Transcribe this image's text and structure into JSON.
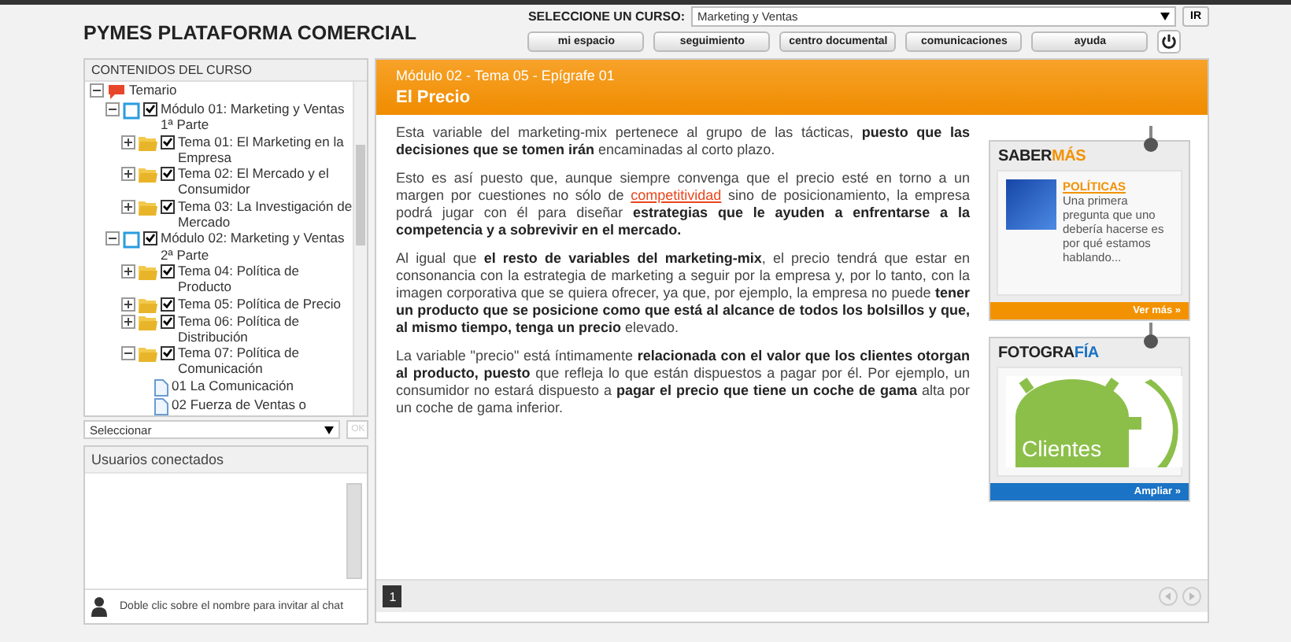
{
  "header": {
    "title": "PYMES PLATAFORMA COMERCIAL",
    "course_label": "SELECCIONE UN CURSO:",
    "course_select": {
      "value": "Marketing y Ventas"
    },
    "go_button": "IR",
    "nav": [
      "mi espacio",
      "seguimiento",
      "centro documental",
      "comunicaciones",
      "ayuda"
    ]
  },
  "contents": {
    "title": "CONTENIDOS DEL CURSO",
    "tree": [
      {
        "label": "Temario",
        "kind": "root",
        "expanded": true,
        "children": [
          {
            "label": "Módulo 01: Marketing y Ventas 1ª Parte",
            "kind": "module",
            "expanded": true,
            "children": [
              {
                "label": "Tema 01: El Marketing en la Empresa",
                "kind": "topic",
                "expanded": false
              },
              {
                "label": "Tema 02: El Mercado y el Consumidor",
                "kind": "topic",
                "expanded": false
              },
              {
                "label": "Tema 03: La Investigación de Mercado",
                "kind": "topic",
                "expanded": false
              }
            ]
          },
          {
            "label": "Módulo 02: Marketing y Ventas 2ª Parte",
            "kind": "module",
            "expanded": true,
            "children": [
              {
                "label": "Tema 04: Política de Producto",
                "kind": "topic",
                "expanded": false
              },
              {
                "label": "Tema 05: Política de Precio",
                "kind": "topic",
                "expanded": false
              },
              {
                "label": "Tema 06: Política de Distribución",
                "kind": "topic",
                "expanded": false
              },
              {
                "label": "Tema 07: Política de Comunicación",
                "kind": "topic",
                "expanded": true,
                "children": [
                  {
                    "label": "01 La Comunicación",
                    "kind": "doc"
                  },
                  {
                    "label": "02 Fuerza de Ventas o",
                    "kind": "doc"
                  }
                ]
              }
            ]
          }
        ]
      }
    ],
    "select": {
      "value": "Seleccionar"
    },
    "ok_button": {
      "label": "OK",
      "disabled": true
    }
  },
  "users": {
    "title": "Usuarios conectados",
    "hint": "Doble clic sobre el nombre para invitar al chat"
  },
  "lesson": {
    "breadcrumb": "Módulo 02 - Tema 05 - Epígrafe 01",
    "title": "El Precio",
    "paragraphs": [
      {
        "parts": [
          {
            "kind": "text",
            "text": "Esta variable del marketing-mix pertenece al grupo de las tácticas, **puesto que las decisiones que se tomen irán** encaminadas al corto plazo."
          }
        ]
      },
      {
        "parts": [
          {
            "kind": "text",
            "text": "Esto es así puesto que, aunque siempre convenga que el precio esté en torno a un margen por cuestiones no sólo de "
          },
          {
            "kind": "link",
            "text": "competitividad"
          },
          {
            "kind": "text",
            "text": " sino de posicionamiento, la empresa podrá jugar con él para diseñar **estrategias que le ayuden a enfrentarse a la competencia y a sobrevivir en el mercado.**"
          }
        ]
      },
      {
        "parts": [
          {
            "kind": "text",
            "text": "Al igual que **el resto de variables del marketing-mix**, el precio tendrá que estar en consonancia con la estrategia de marketing a seguir por la empresa y, por lo tanto, con la imagen corporativa que se quiera ofrecer, ya que, por ejemplo, la empresa no puede **tener un producto que se posicione como que está al alcance de todos los bolsillos y que, al mismo tiempo, tenga un precio** elevado."
          }
        ]
      },
      {
        "parts": [
          {
            "kind": "text",
            "text": "La variable \"precio\" está íntimamente **relacionada con el valor que los clientes otorgan al producto, puesto** que refleja lo que están dispuestos a pagar por él. Por ejemplo, un consumidor no estará dispuesto a **pagar el precio que tiene un coche de gama** alta por un coche de gama inferior."
          }
        ]
      }
    ],
    "page_button": "1"
  },
  "cards": [
    {
      "kind": "article",
      "title_main": "SABER",
      "title_accent": "MÁS",
      "heading": "POLÍTICAS",
      "text": "Una primera pregunta que uno debería hacerse es por qué estamos hablando...",
      "footer": "Ver más »",
      "color": "#f39200"
    },
    {
      "kind": "image",
      "title_main": "FOTOGRA",
      "title_accent": "FÍA",
      "image_text": "Clientes",
      "footer": "Ampliar »",
      "color": "#1a73c4"
    }
  ]
}
